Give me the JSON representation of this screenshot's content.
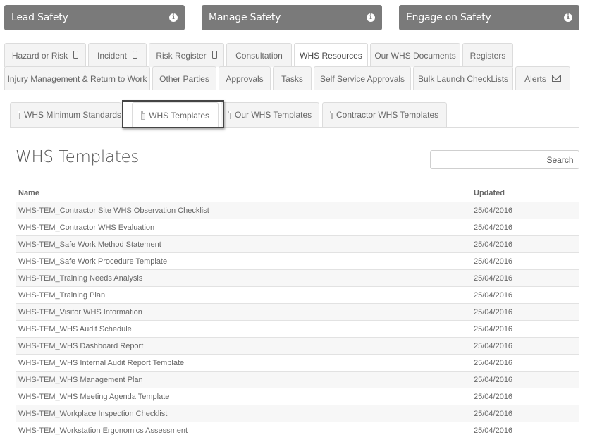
{
  "banners": [
    {
      "label": "Lead Safety",
      "icon": "info-icon"
    },
    {
      "label": "Manage Safety",
      "icon": "info-icon"
    },
    {
      "label": "Engage on Safety",
      "icon": "info-icon"
    }
  ],
  "main_tabs": {
    "row1": [
      {
        "label": "Hazard or Risk",
        "icon": "phone-icon"
      },
      {
        "label": "Incident",
        "icon": "phone-icon"
      },
      {
        "label": "Risk Register",
        "icon": "phone-icon"
      },
      {
        "label": "Consultation"
      },
      {
        "label": "WHS Resources",
        "active": true
      },
      {
        "label": "Our WHS Documents"
      },
      {
        "label": "Registers"
      }
    ],
    "row2": [
      {
        "label": "Injury Management & Return to Work"
      },
      {
        "label": "Other Parties"
      },
      {
        "label": "Approvals"
      },
      {
        "label": "Tasks"
      },
      {
        "label": "Self Service Approvals"
      },
      {
        "label": "Bulk Launch CheckLists"
      },
      {
        "label": "Alerts",
        "icon": "mail-icon"
      }
    ]
  },
  "sub_tabs": [
    {
      "label": "WHS Minimum Standards",
      "icon": "document-icon"
    },
    {
      "label": "WHS Templates",
      "icon": "document-icon",
      "active": true
    },
    {
      "label": "Our WHS Templates",
      "icon": "document-icon"
    },
    {
      "label": "Contractor WHS Templates",
      "icon": "document-icon"
    }
  ],
  "page": {
    "title": "WHS Templates",
    "search": {
      "value": "",
      "placeholder": "",
      "button_label": "Search"
    }
  },
  "table": {
    "headers": {
      "name": "Name",
      "updated": "Updated"
    },
    "rows": [
      {
        "name": "WHS-TEM_Contractor Site WHS Observation Checklist",
        "updated": "25/04/2016"
      },
      {
        "name": "WHS-TEM_Contractor WHS Evaluation",
        "updated": "25/04/2016"
      },
      {
        "name": "WHS-TEM_Safe Work Method Statement",
        "updated": "25/04/2016"
      },
      {
        "name": "WHS-TEM_Safe Work Procedure Template",
        "updated": "25/04/2016"
      },
      {
        "name": "WHS-TEM_Training Needs Analysis",
        "updated": "25/04/2016"
      },
      {
        "name": "WHS-TEM_Training Plan",
        "updated": "25/04/2016"
      },
      {
        "name": "WHS-TEM_Visitor WHS Information",
        "updated": "25/04/2016"
      },
      {
        "name": "WHS-TEM_WHS Audit Schedule",
        "updated": "25/04/2016"
      },
      {
        "name": "WHS-TEM_WHS Dashboard Report",
        "updated": "25/04/2016"
      },
      {
        "name": "WHS-TEM_WHS Internal Audit Report Template",
        "updated": "25/04/2016"
      },
      {
        "name": "WHS-TEM_WHS Management Plan",
        "updated": "25/04/2016"
      },
      {
        "name": "WHS-TEM_WHS Meeting Agenda Template",
        "updated": "25/04/2016"
      },
      {
        "name": "WHS-TEM_Workplace Inspection Checklist",
        "updated": "25/04/2016"
      },
      {
        "name": "WHS-TEM_Workstation Ergonomics Assessment",
        "updated": "25/04/2016"
      }
    ]
  },
  "colors": {
    "banner_bg": "#7a7a7a",
    "tab_bg": "#f4f4f4",
    "tab_active_bg": "#ffffff",
    "highlight_border": "#444444"
  }
}
